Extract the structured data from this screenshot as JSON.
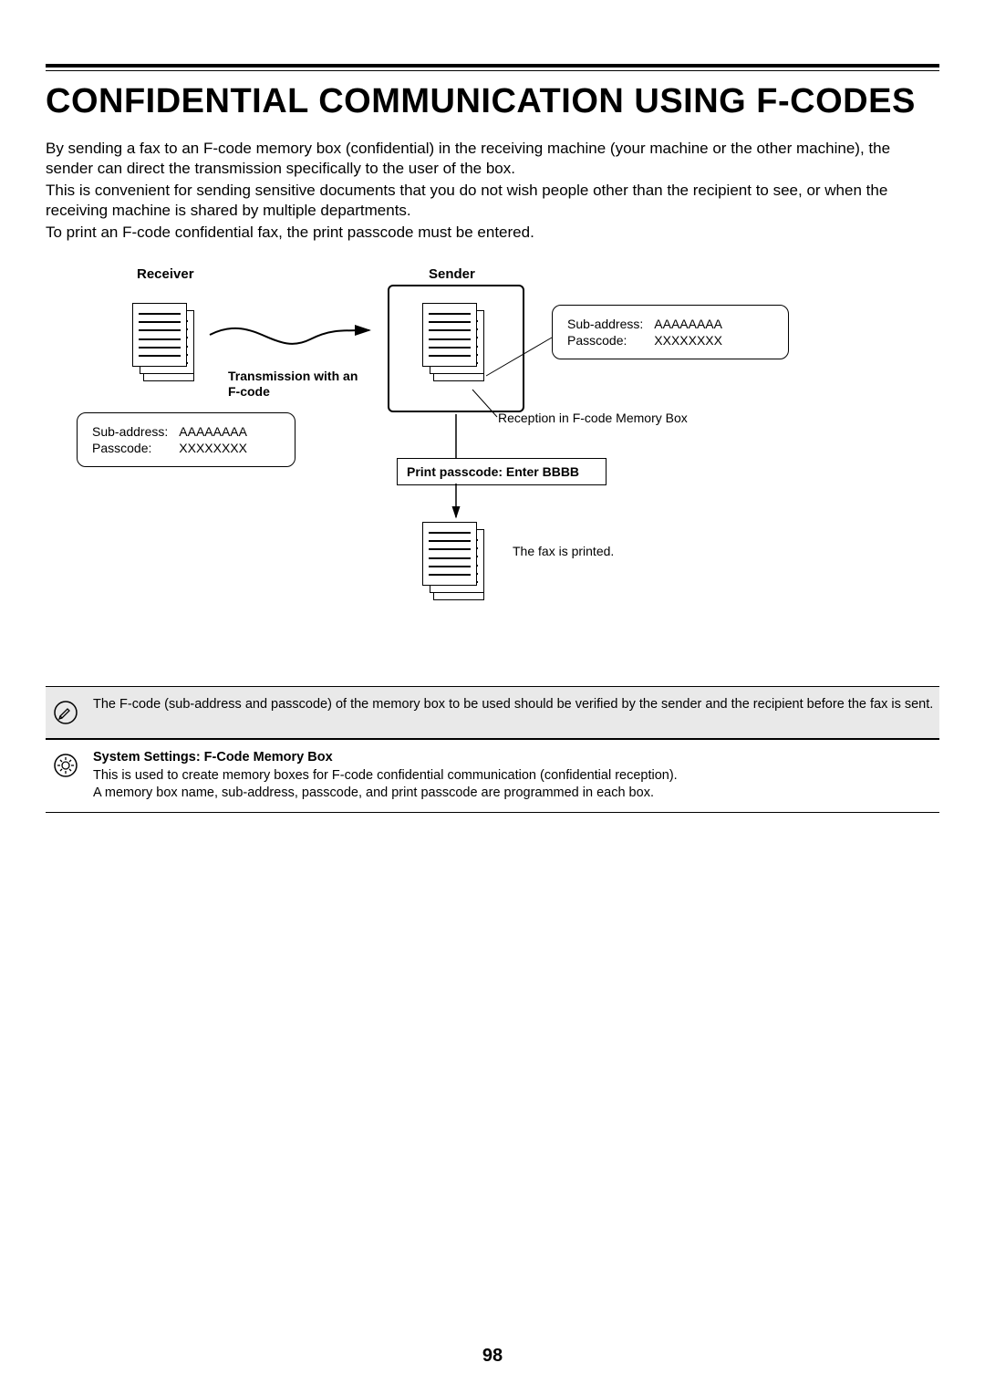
{
  "title": "CONFIDENTIAL COMMUNICATION USING F-CODES",
  "intro": {
    "p1": "By sending a fax to an F-code memory box (confidential) in the receiving machine (your machine or the other machine), the sender can direct the transmission specifically to the user of the box.",
    "p2": "This is convenient for sending sensitive documents that you do not wish people other than the recipient to see, or when the receiving machine is shared by multiple departments.",
    "p3": "To print an F-code confidential fax, the print passcode must be entered."
  },
  "diagram": {
    "receiver_label": "Receiver",
    "sender_label": "Sender",
    "transmission_label_l1": "Transmission with an",
    "transmission_label_l2": "F-code",
    "sub_address_label": "Sub-address:",
    "passcode_label": "Passcode:",
    "sub_address_value": "AAAAAAAA",
    "passcode_value": "XXXXXXXX",
    "reception_label": "Reception in F-code Memory Box",
    "print_passcode_label": "Print passcode: Enter BBBB",
    "printed_label": "The fax is printed."
  },
  "notes": {
    "info": "The F-code (sub-address and passcode) of the memory box to be used should be verified by the sender and the recipient before the fax is sent.",
    "settings_title": "System Settings: F-Code Memory Box",
    "settings_l1": "This is used to create memory boxes for F-code confidential communication (confidential reception).",
    "settings_l2": "A memory box name, sub-address, passcode, and print passcode are programmed in each box."
  },
  "page_number": "98"
}
